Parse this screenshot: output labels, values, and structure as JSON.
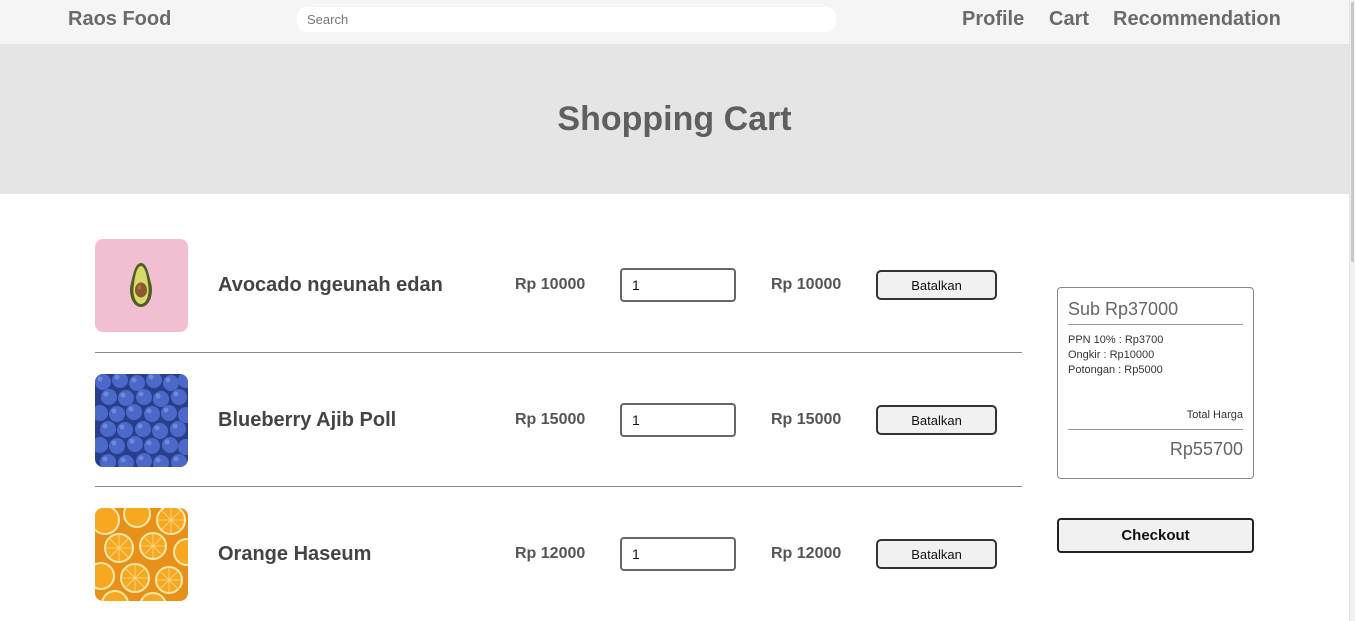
{
  "nav": {
    "brand": "Raos Food",
    "search_placeholder": "Search",
    "links": [
      "Profile",
      "Cart",
      "Recommendation"
    ]
  },
  "hero": {
    "title": "Shopping Cart"
  },
  "cart": {
    "items": [
      {
        "name": "Avocado ngeunah edan",
        "price": "Rp 10000",
        "qty": "1",
        "total": "Rp 10000",
        "cancel_label": "Batalkan",
        "image": "avocado-image"
      },
      {
        "name": "Blueberry Ajib Poll",
        "price": "Rp 15000",
        "qty": "1",
        "total": "Rp 15000",
        "cancel_label": "Batalkan",
        "image": "blueberry-image"
      },
      {
        "name": "Orange Haseum",
        "price": "Rp 12000",
        "qty": "1",
        "total": "Rp 12000",
        "cancel_label": "Batalkan",
        "image": "orange-image"
      }
    ]
  },
  "summary": {
    "subtotal": "Sub Rp37000",
    "ppn": "PPN 10% : Rp3700",
    "ongkir": "Ongkir : Rp10000",
    "potongan": "Potongan : Rp5000",
    "total_label": "Total Harga",
    "total_value": "Rp55700",
    "checkout_label": "Checkout"
  },
  "colors": {
    "nav_bg": "#f5f5f5",
    "hero_bg": "#e5e5e5",
    "text_gray": "#6a6a6a"
  }
}
